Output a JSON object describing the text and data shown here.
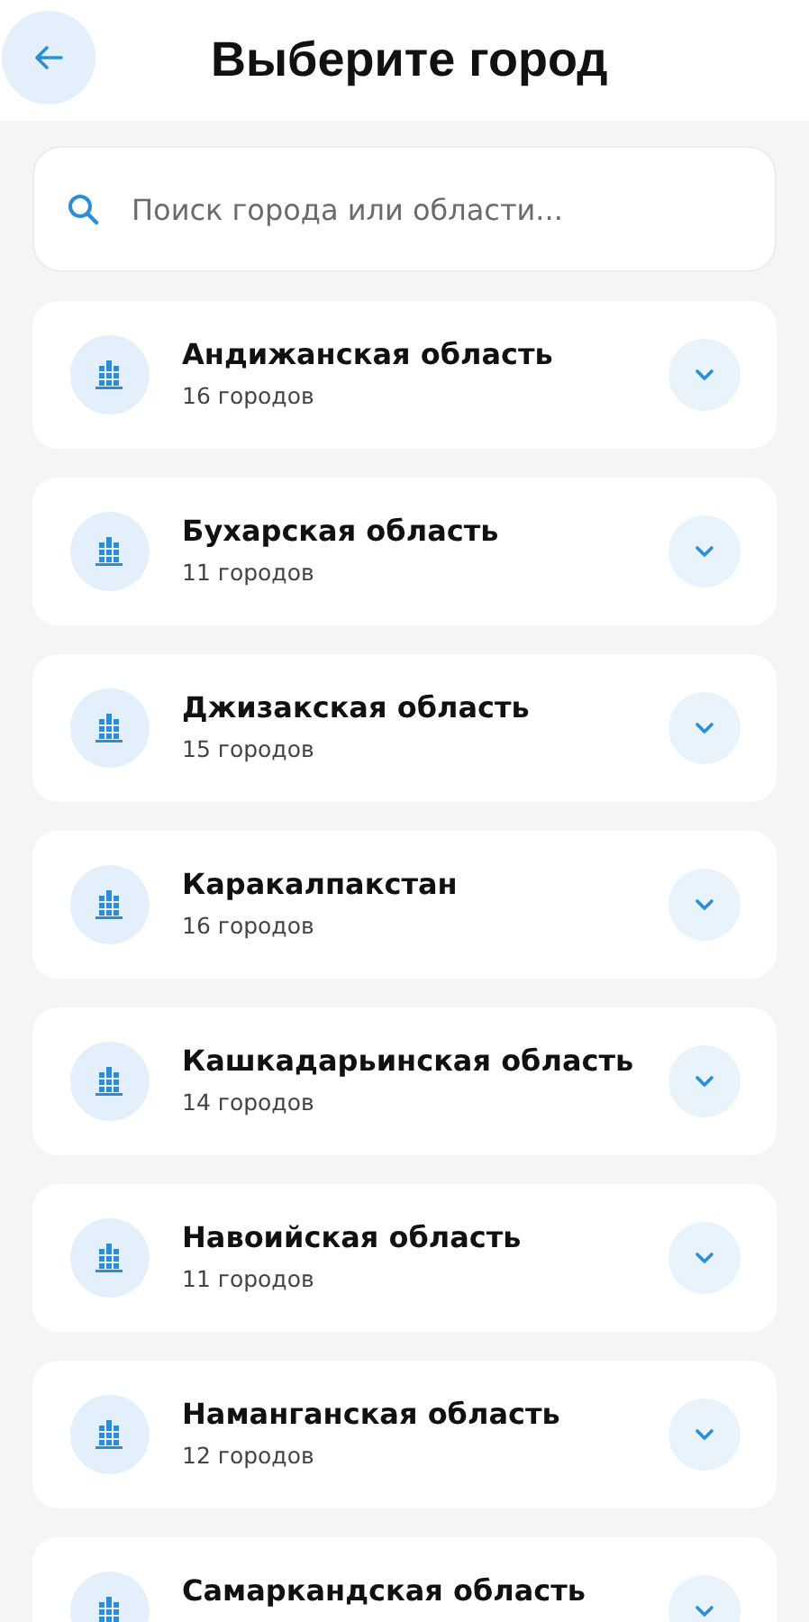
{
  "header": {
    "title": "Выберите город"
  },
  "search": {
    "placeholder": "Поиск города или области..."
  },
  "regions": [
    {
      "name": "Андижанская область",
      "count": "16 городов",
      "expanded": false
    },
    {
      "name": "Бухарская область",
      "count": "11 городов",
      "expanded": false
    },
    {
      "name": "Джизакская область",
      "count": "15 городов",
      "expanded": false
    },
    {
      "name": "Каракалпакстан",
      "count": "16 городов",
      "expanded": false
    },
    {
      "name": "Кашкадарьинская область",
      "count": "14 городов",
      "expanded": false
    },
    {
      "name": "Навоийская область",
      "count": "11 городов",
      "expanded": false
    },
    {
      "name": "Наманганская область",
      "count": "12 городов",
      "expanded": false
    },
    {
      "name": "Самаркандская область",
      "expanded": false
    }
  ]
}
